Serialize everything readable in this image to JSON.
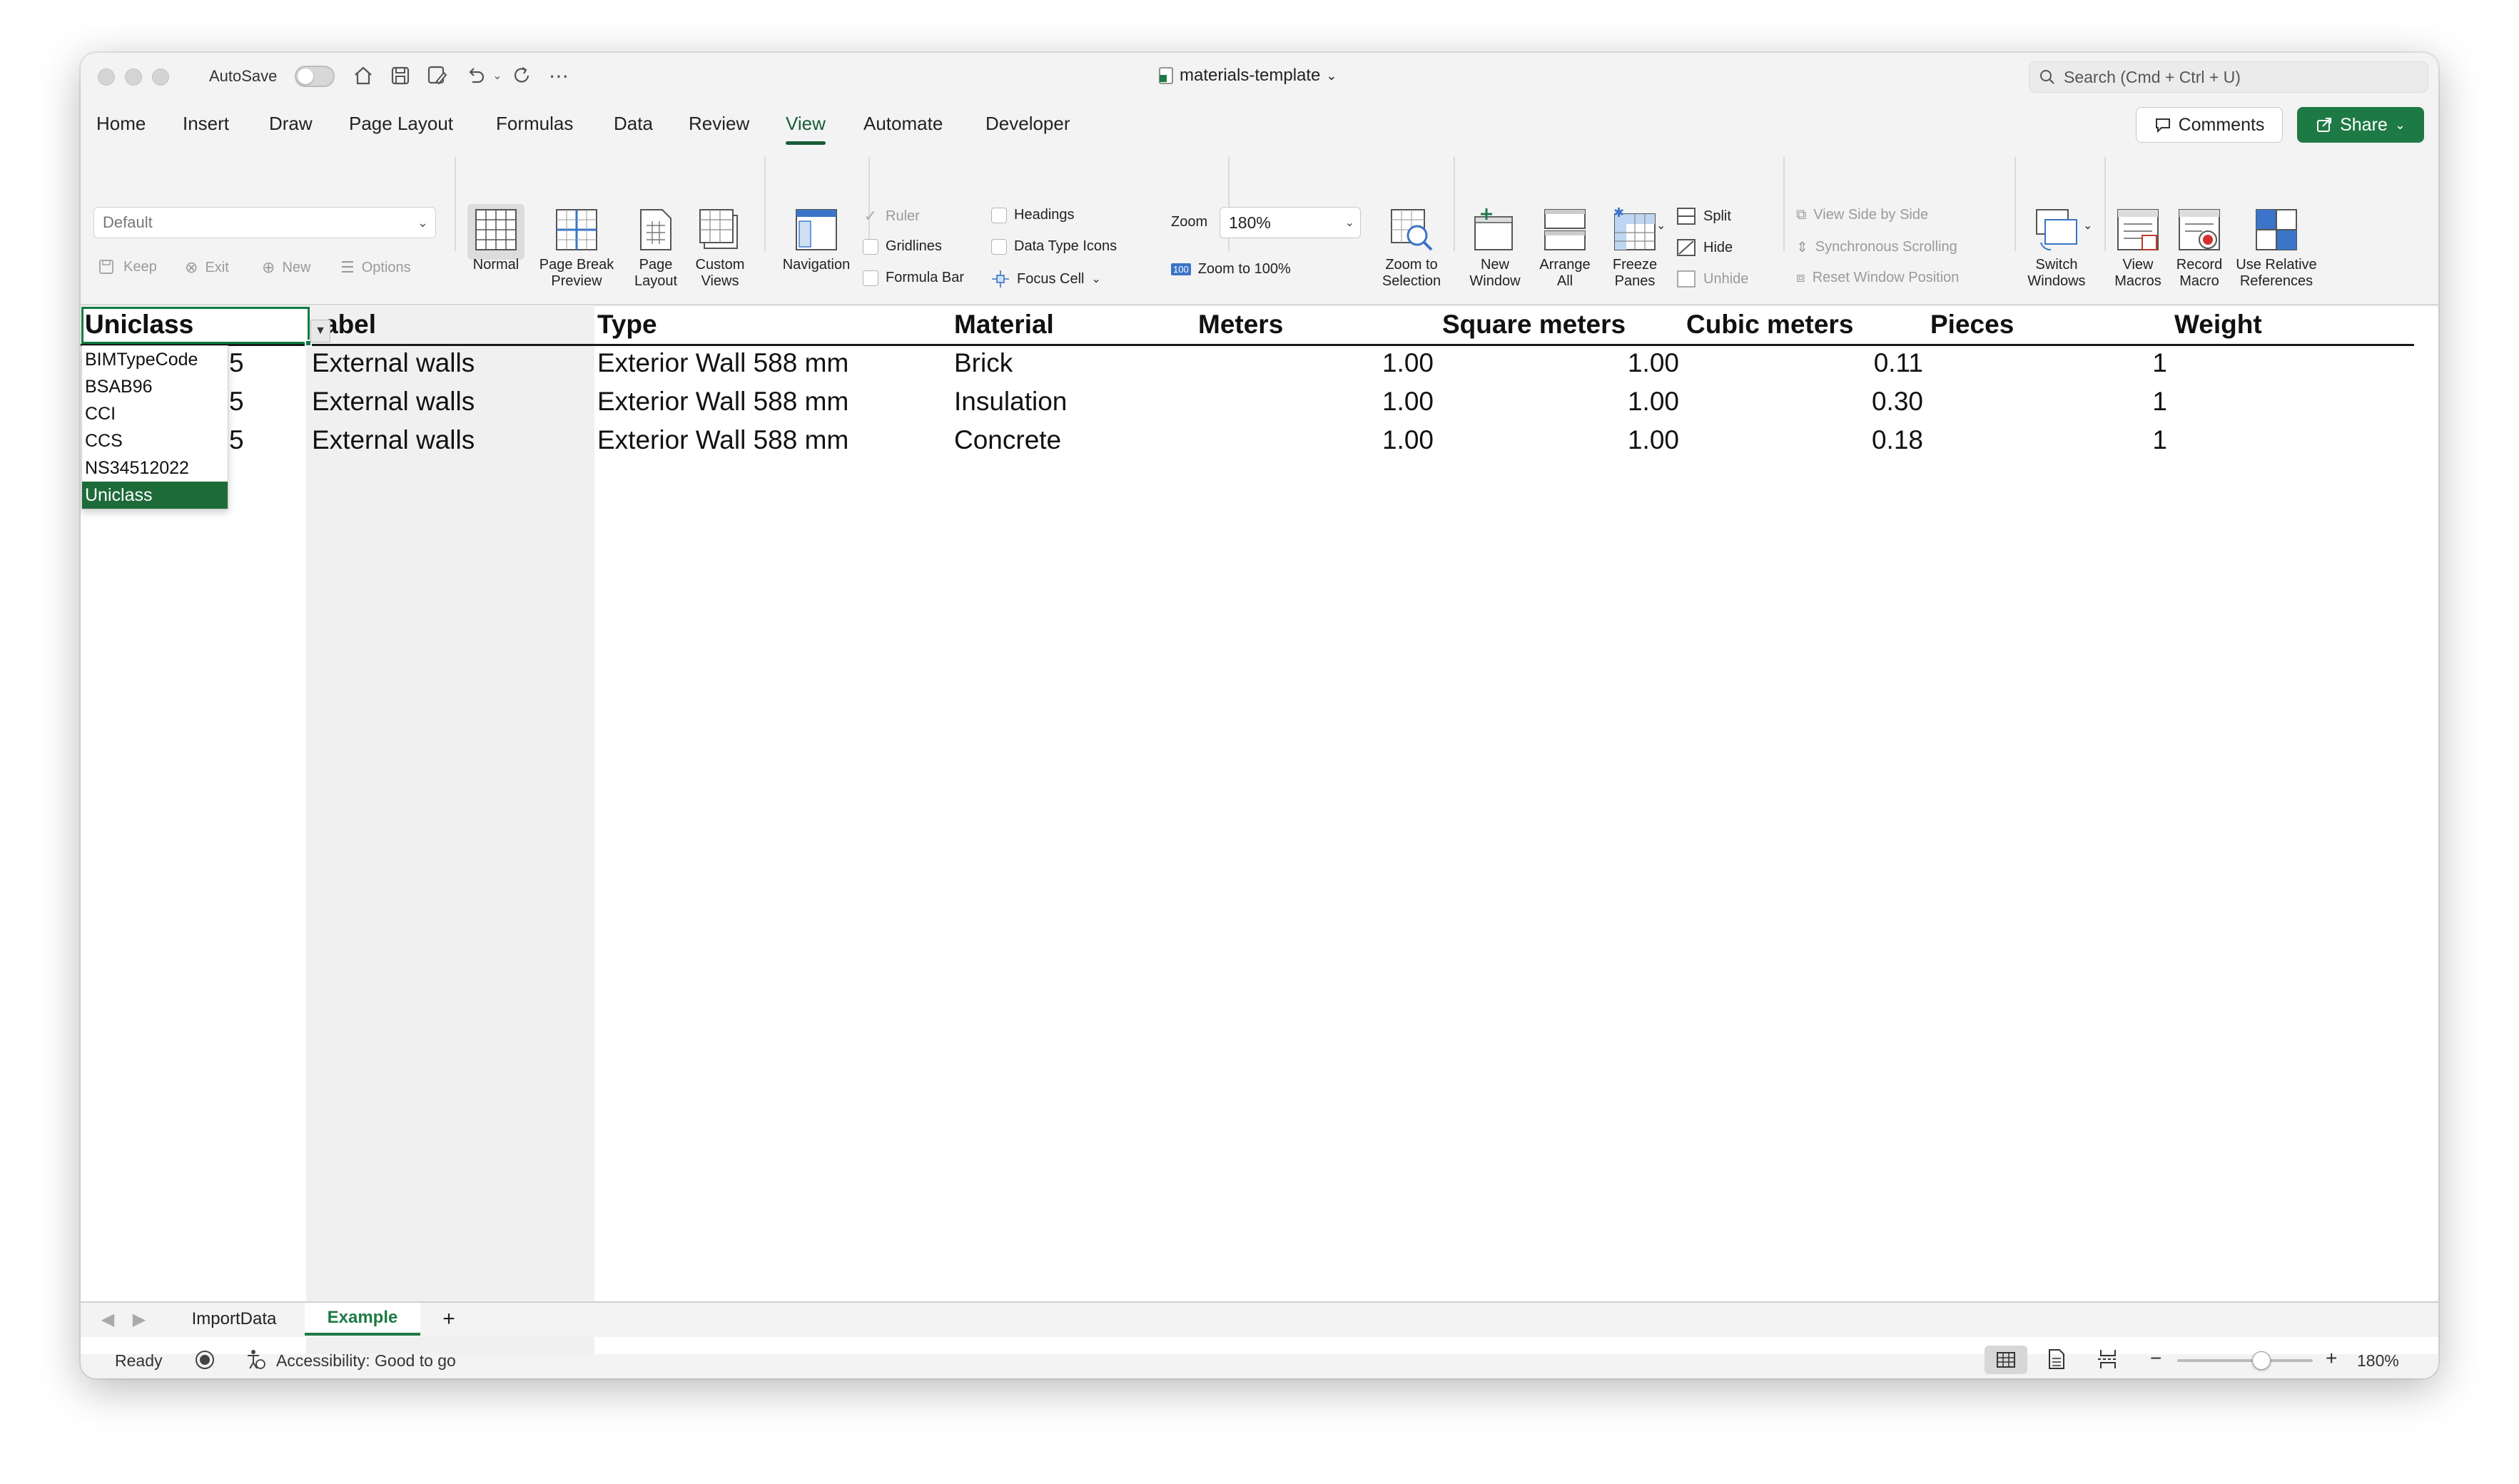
{
  "titlebar": {
    "autosave_label": "AutoSave",
    "document_title": "materials-template",
    "search_placeholder": "Search (Cmd + Ctrl + U)"
  },
  "tabs": [
    "Home",
    "Insert",
    "Draw",
    "Page Layout",
    "Formulas",
    "Data",
    "Review",
    "View",
    "Automate",
    "Developer"
  ],
  "active_tab": "View",
  "buttons": {
    "comments": "Comments",
    "share": "Share"
  },
  "ribbon": {
    "sheet_view_value": "Default",
    "keep": "Keep",
    "exit": "Exit",
    "new": "New",
    "options": "Options",
    "normal": "Normal",
    "page_break_preview_1": "Page Break",
    "page_break_preview_2": "Preview",
    "page_layout_1": "Page",
    "page_layout_2": "Layout",
    "custom_views_1": "Custom",
    "custom_views_2": "Views",
    "navigation": "Navigation",
    "ruler": "Ruler",
    "gridlines": "Gridlines",
    "formula_bar": "Formula Bar",
    "headings": "Headings",
    "data_type_icons": "Data Type Icons",
    "focus_cell": "Focus Cell",
    "zoom_label": "Zoom",
    "zoom_value": "180%",
    "zoom_100_icon_text": "100",
    "zoom_to_100": "Zoom to 100%",
    "zoom_to_selection_1": "Zoom to",
    "zoom_to_selection_2": "Selection",
    "new_window_1": "New",
    "new_window_2": "Window",
    "arrange_all_1": "Arrange",
    "arrange_all_2": "All",
    "freeze_panes_1": "Freeze",
    "freeze_panes_2": "Panes",
    "split": "Split",
    "hide": "Hide",
    "unhide": "Unhide",
    "view_side_by_side": "View Side by Side",
    "synchronous_scrolling": "Synchronous Scrolling",
    "reset_window_position": "Reset Window Position",
    "switch_windows_1": "Switch",
    "switch_windows_2": "Windows",
    "view_macros_1": "View",
    "view_macros_2": "Macros",
    "record_macro_1": "Record",
    "record_macro_2": "Macro",
    "use_relative_1": "Use Relative",
    "use_relative_2": "References"
  },
  "sheet": {
    "headers": [
      "Uniclass",
      "Label",
      "Type",
      "Material",
      "Meters",
      "Square meters",
      "Cubic meters",
      "Pieces",
      "Weight"
    ],
    "label_header_visible": "abel",
    "rows": [
      {
        "col_a_partial": "5",
        "label": "External walls",
        "type": "Exterior Wall 588 mm",
        "material": "Brick",
        "square_meters": "1.00",
        "cubic_meters": "1.00",
        "pieces": "0.11",
        "weight": "1"
      },
      {
        "col_a_partial": "5",
        "label": "External walls",
        "type": "Exterior Wall 588 mm",
        "material": "Insulation",
        "square_meters": "1.00",
        "cubic_meters": "1.00",
        "pieces": "0.30",
        "weight": "1"
      },
      {
        "col_a_partial": "5",
        "label": "External walls",
        "type": "Exterior Wall 588 mm",
        "material": "Concrete",
        "square_meters": "1.00",
        "cubic_meters": "1.00",
        "pieces": "0.18",
        "weight": "1"
      }
    ],
    "dropdown_options": [
      "BIMTypeCode",
      "BSAB96",
      "CCI",
      "CCS",
      "NS34512022",
      "Uniclass"
    ],
    "dropdown_selected": "Uniclass"
  },
  "sheet_tabs": [
    "ImportData",
    "Example"
  ],
  "active_sheet": "Example",
  "add_sheet": "+",
  "statusbar": {
    "ready": "Ready",
    "accessibility": "Accessibility: Good to go",
    "zoom_minus": "−",
    "zoom_plus": "+",
    "zoom": "180%",
    "zoom_level": 0.62
  },
  "colors": {
    "accent": "#1e7a45",
    "active_tab": "#185c37"
  }
}
